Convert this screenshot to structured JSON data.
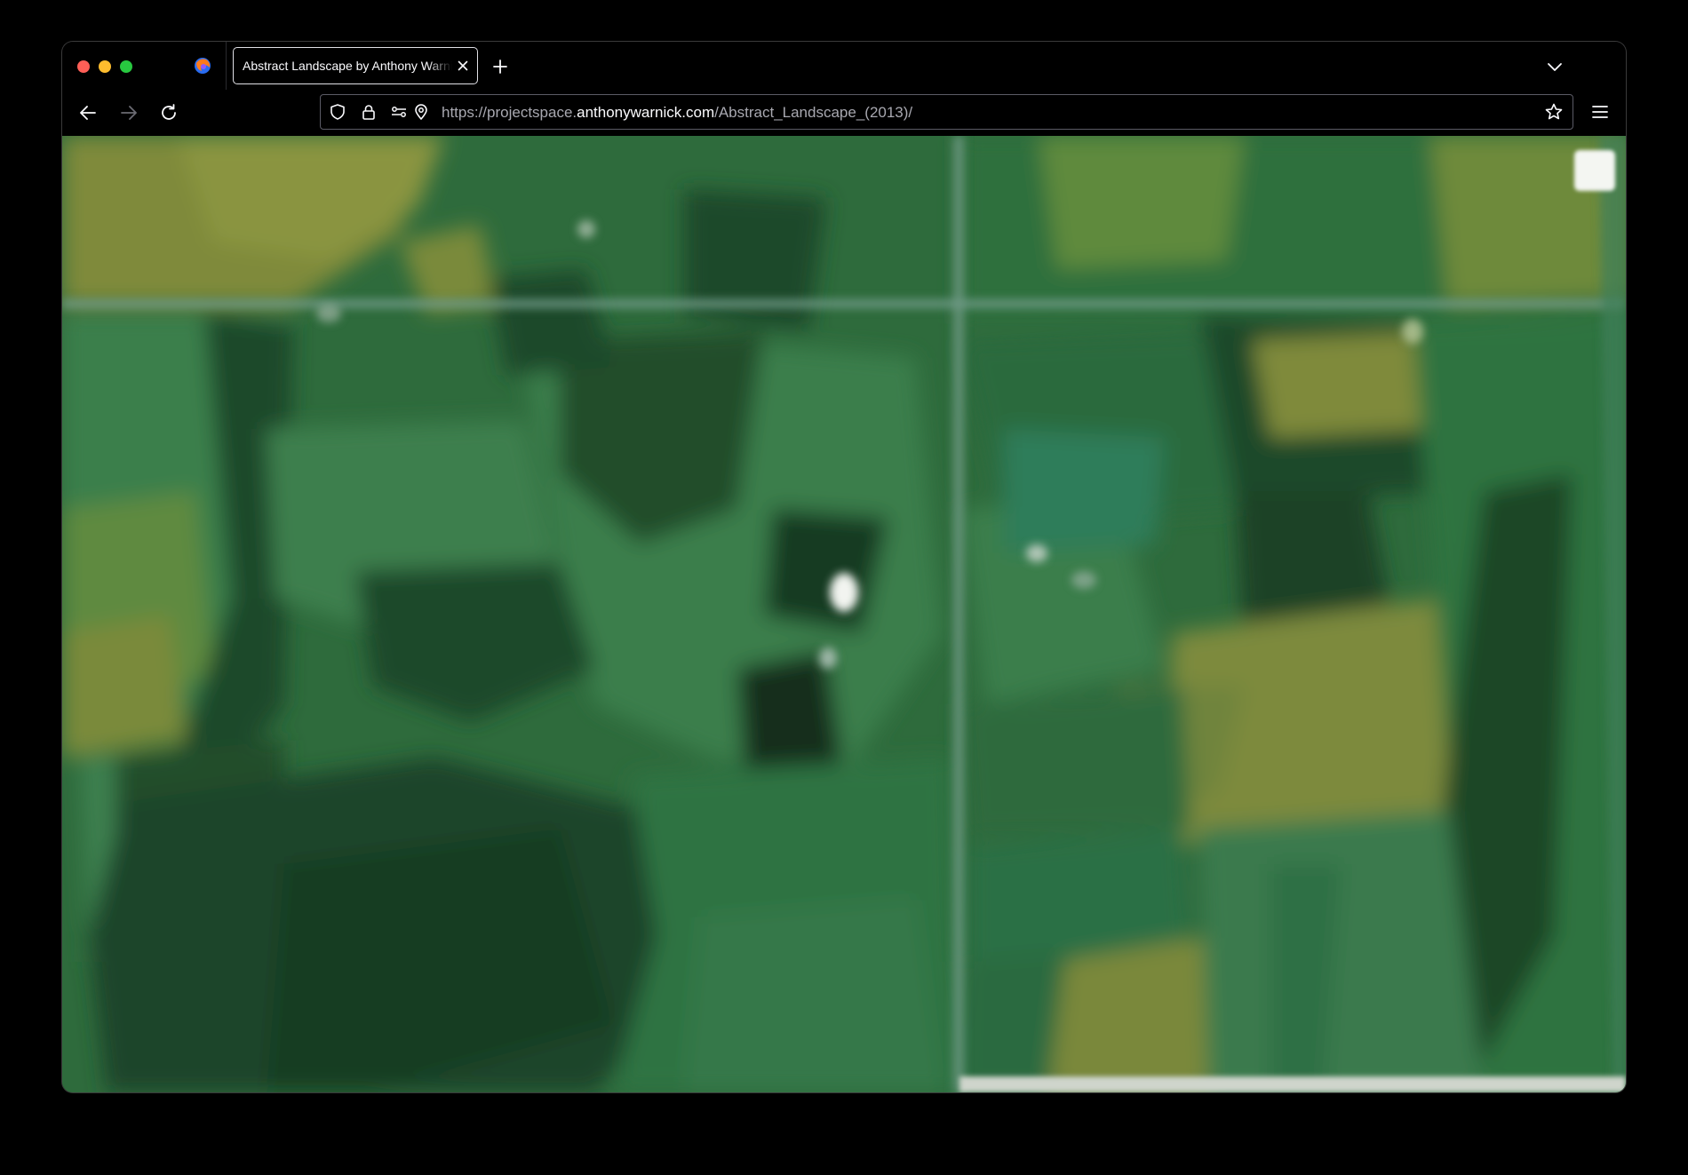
{
  "browser": {
    "tab": {
      "title": "Abstract Landscape by Anthony Warnick",
      "close_icon": "close-icon"
    },
    "new_tab_icon": "plus-icon",
    "tab_list_icon": "chevron-down-icon",
    "nav": {
      "back_icon": "arrow-left-icon",
      "forward_icon": "arrow-right-icon",
      "reload_icon": "reload-icon"
    },
    "url": {
      "prefix": "https://projectspace.",
      "domain": "anthonywarnick.com",
      "path": "/Abstract_Landscape_(2013)/"
    },
    "bookmark_icon": "star-icon",
    "menu_icon": "hamburger-menu-icon"
  },
  "page": {
    "content": "blurred aerial satellite landscape image",
    "colors": {
      "field_dark": "#1f4a2a",
      "field_mid": "#2e6b3c",
      "field_light": "#3f8a55",
      "field_yellow": "#7f8a3a",
      "road": "#6f9a86"
    }
  }
}
